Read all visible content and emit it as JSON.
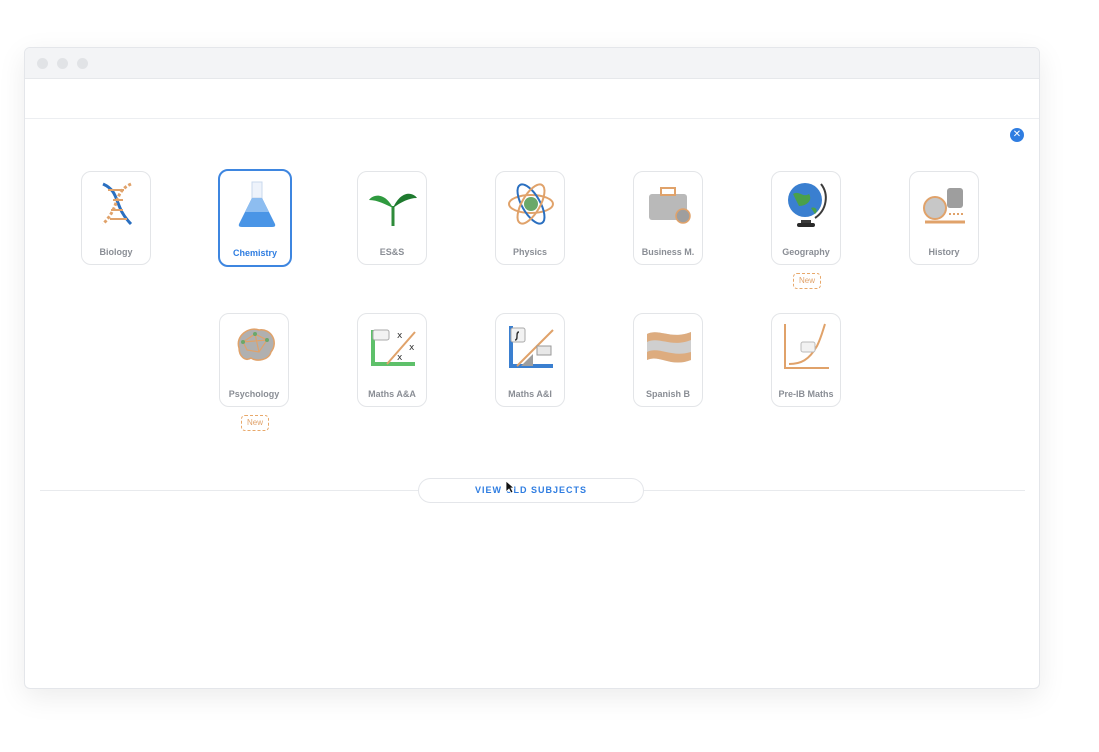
{
  "close_label": "✕",
  "subjects": [
    {
      "label": "Biology",
      "icon": "dna-icon",
      "selected": false
    },
    {
      "label": "Chemistry",
      "icon": "flask-icon",
      "selected": true
    },
    {
      "label": "ES&S",
      "icon": "sprout-icon",
      "selected": false
    },
    {
      "label": "Physics",
      "icon": "atom-icon",
      "selected": false
    },
    {
      "label": "Business M.",
      "icon": "briefcase-icon",
      "selected": false
    },
    {
      "label": "Geography",
      "icon": "globe-icon",
      "selected": false,
      "badge": "New"
    },
    {
      "label": "History",
      "icon": "scroll-icon",
      "selected": false
    },
    {
      "label": "Psychology",
      "icon": "brain-icon",
      "selected": false,
      "badge": "New"
    },
    {
      "label": "Maths A&A",
      "icon": "algebra-icon",
      "selected": false
    },
    {
      "label": "Maths A&I",
      "icon": "integral-icon",
      "selected": false
    },
    {
      "label": "Spanish B",
      "icon": "flag-icon",
      "selected": false
    },
    {
      "label": "Pre-IB Maths",
      "icon": "graph-icon",
      "selected": false
    }
  ],
  "view_old_subjects": "VIEW OLD SUBJECTS",
  "colors": {
    "accent": "#2f7de1",
    "badge": "#e0a26a",
    "muted_label": "#8a8e95"
  }
}
